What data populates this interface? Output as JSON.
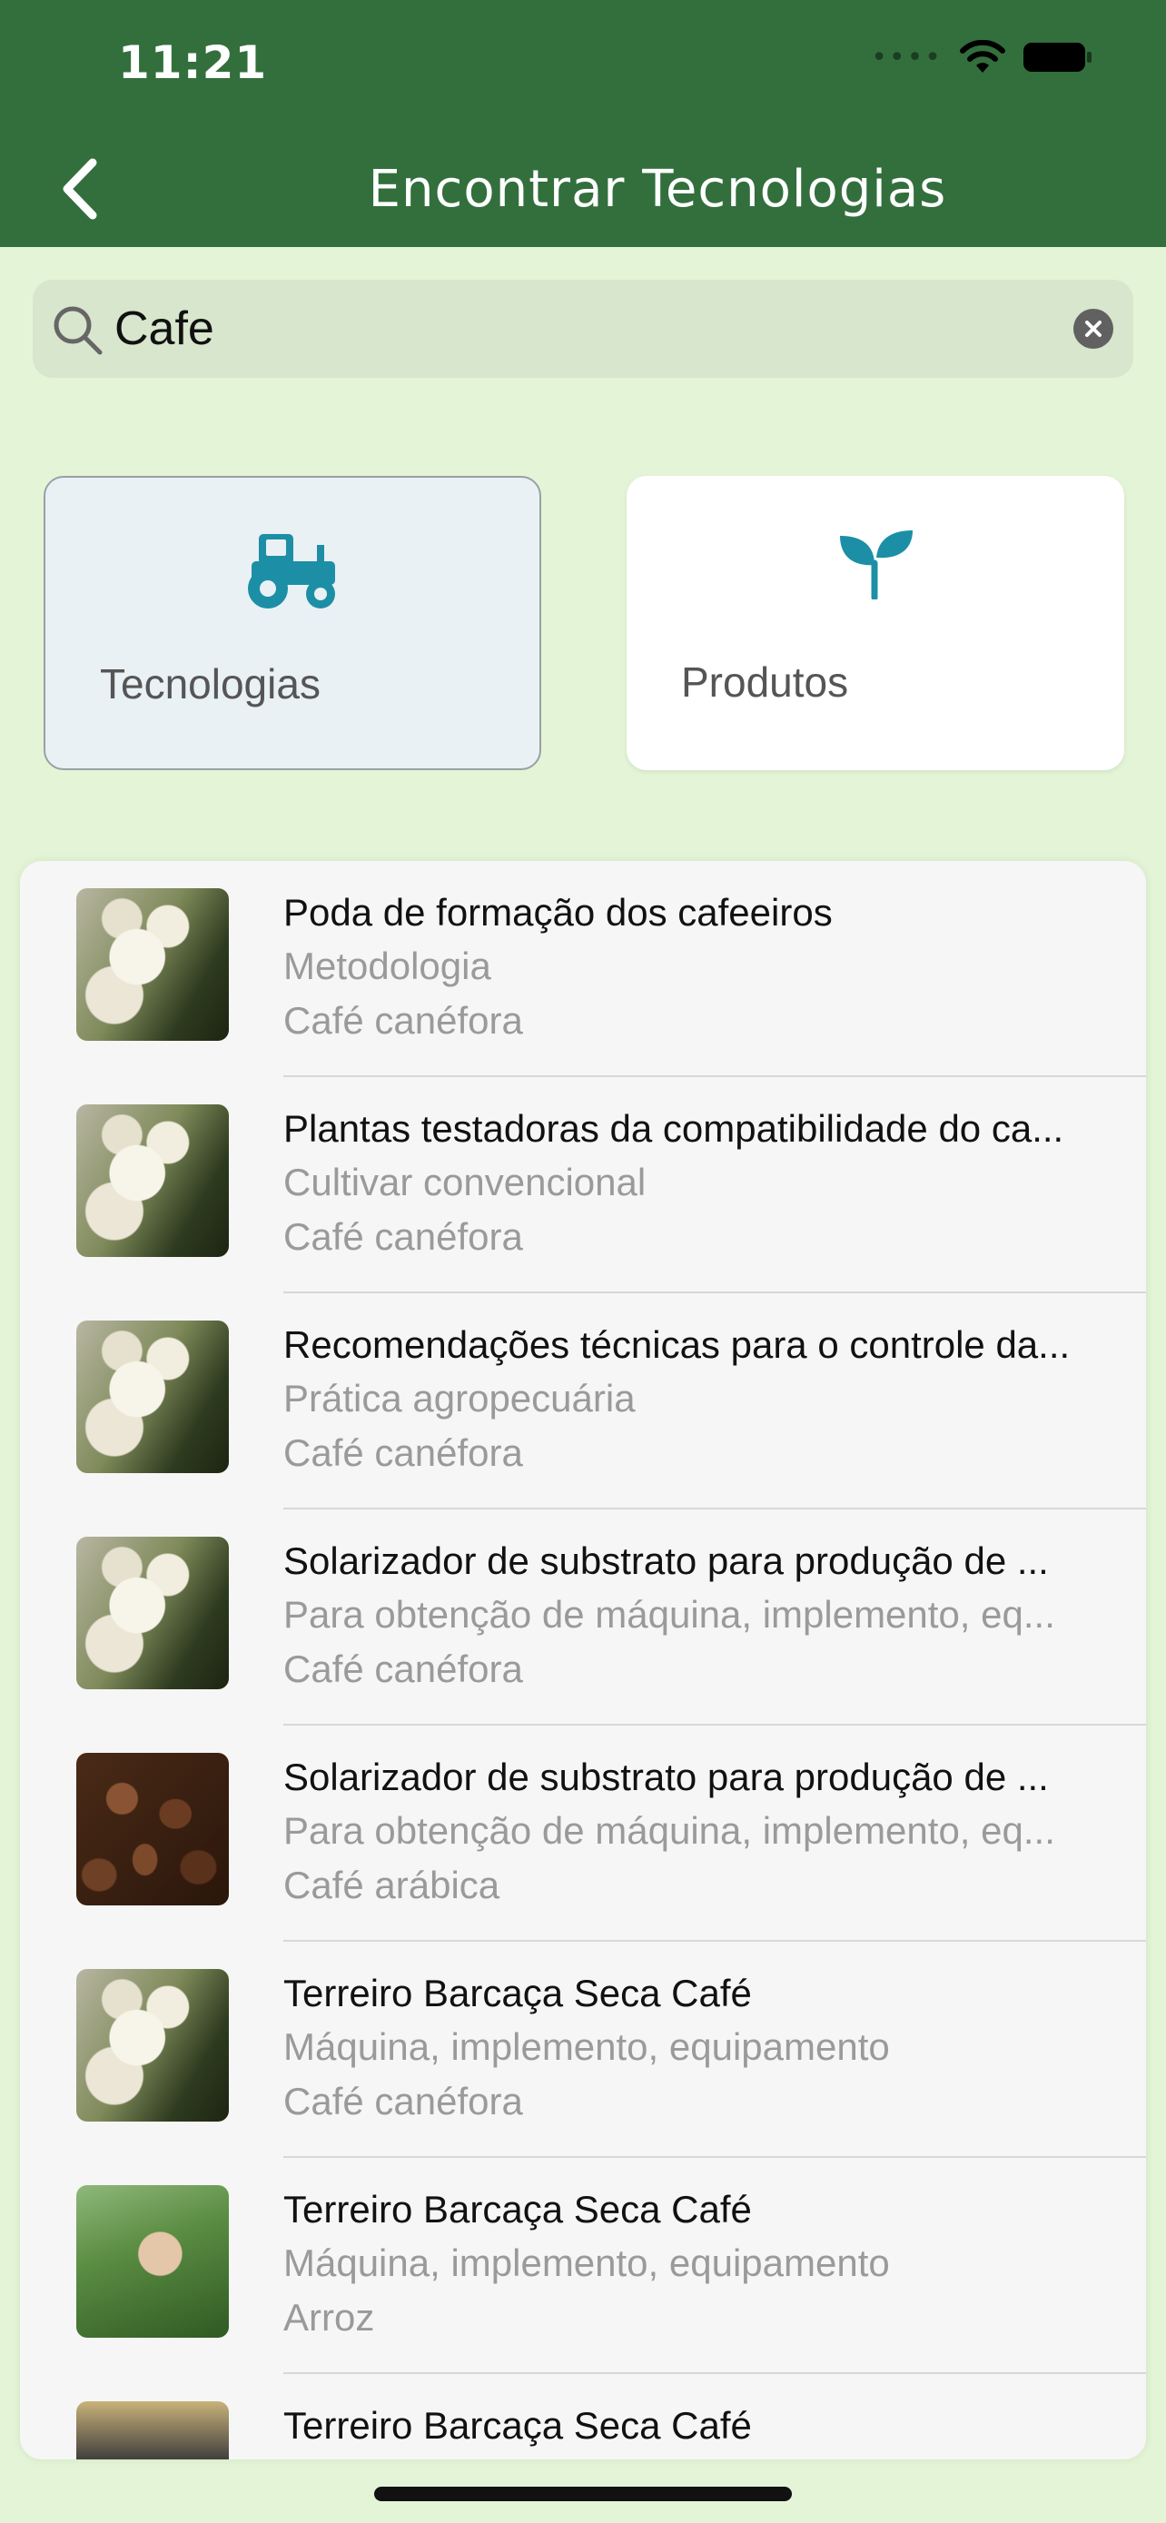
{
  "status_bar": {
    "time": "11:21"
  },
  "header": {
    "title": "Encontrar Tecnologias"
  },
  "search": {
    "value": "Cafe",
    "placeholder": ""
  },
  "categories": [
    {
      "label": "Tecnologias",
      "icon": "tractor-icon",
      "selected": true
    },
    {
      "label": "Produtos",
      "icon": "sprout-icon",
      "selected": false
    }
  ],
  "colors": {
    "header_bg": "#326f3c",
    "accent": "#1c8fa6",
    "page_bg": "#e3f5d6"
  },
  "results": [
    {
      "title": "Poda de formação dos cafeeiros",
      "type": "Metodologia",
      "crop": "Café canéfora",
      "image": "coffee-flower"
    },
    {
      "title": "Plantas testadoras da compatibilidade do ca...",
      "type": "Cultivar convencional",
      "crop": "Café canéfora",
      "image": "coffee-flower"
    },
    {
      "title": "Recomendações técnicas para o controle da...",
      "type": "Prática agropecuária",
      "crop": "Café canéfora",
      "image": "coffee-flower"
    },
    {
      "title": "Solarizador de substrato para produção de ...",
      "type": "Para obtenção de máquina, implemento, eq...",
      "crop": "Café canéfora",
      "image": "coffee-flower"
    },
    {
      "title": "Solarizador de substrato para produção de ...",
      "type": "Para obtenção de máquina, implemento, eq...",
      "crop": "Café arábica",
      "image": "coffee-beans"
    },
    {
      "title": "Terreiro Barcaça Seca Café",
      "type": "Máquina, implemento, equipamento",
      "crop": "Café canéfora",
      "image": "coffee-flower"
    },
    {
      "title": "Terreiro Barcaça Seca Café",
      "type": "Máquina, implemento, equipamento",
      "crop": "Arroz",
      "image": "rice-field"
    },
    {
      "title": "Terreiro Barcaça Seca Café",
      "type": "",
      "crop": "",
      "image": "dark-grains"
    }
  ]
}
